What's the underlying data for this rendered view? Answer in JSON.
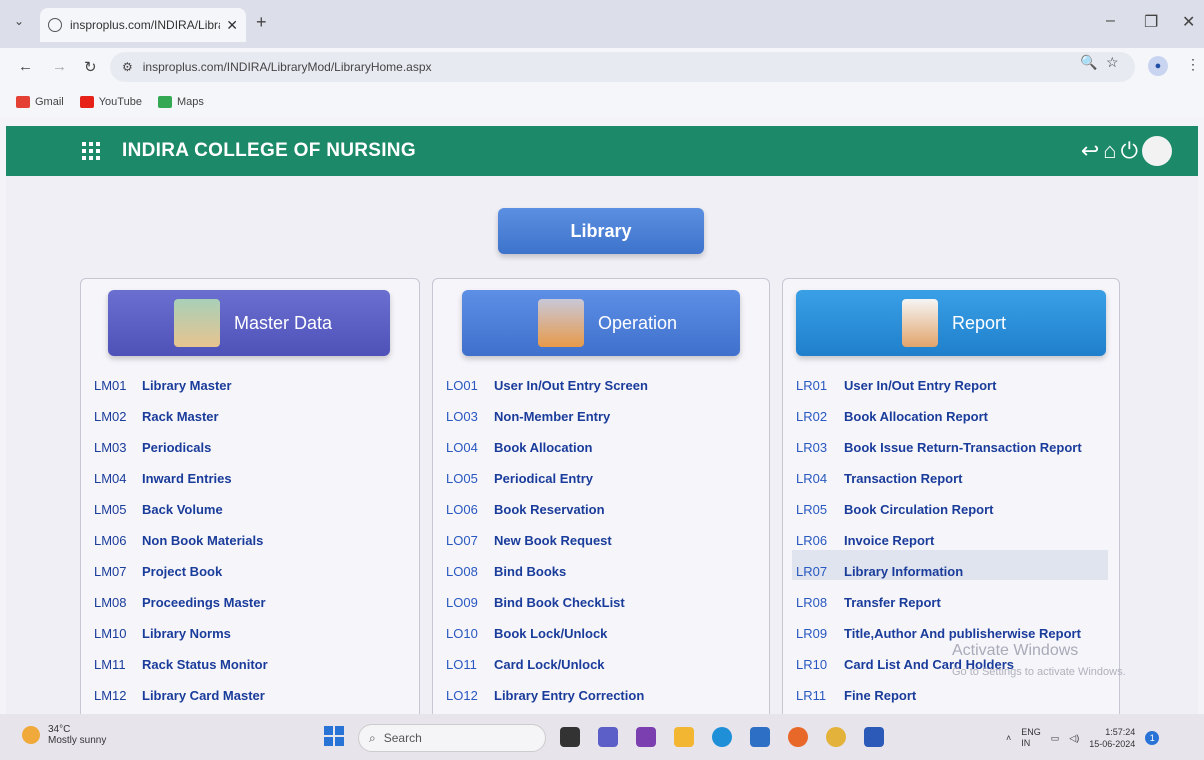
{
  "browser": {
    "tab_title": "insproplus.com/INDIRA/Librar",
    "url": "insproplus.com/INDIRA/LibraryMod/LibraryHome.aspx",
    "bookmarks": [
      "Gmail",
      "YouTube",
      "Maps"
    ]
  },
  "app": {
    "title": "INDIRA COLLEGE OF NURSING",
    "module_button": "Library"
  },
  "panels": [
    {
      "title": "Master Data",
      "color": "#5b5fc4",
      "items": [
        {
          "code": "LM01",
          "label": "Library Master"
        },
        {
          "code": "LM02",
          "label": "Rack Master"
        },
        {
          "code": "LM03",
          "label": "Periodicals"
        },
        {
          "code": "LM04",
          "label": "Inward Entries"
        },
        {
          "code": "LM05",
          "label": "Back Volume"
        },
        {
          "code": "LM06",
          "label": "Non Book Materials"
        },
        {
          "code": "LM07",
          "label": "Project Book"
        },
        {
          "code": "LM08",
          "label": "Proceedings Master"
        },
        {
          "code": "LM10",
          "label": "Library Norms"
        },
        {
          "code": "LM11",
          "label": "Rack Status Monitor"
        },
        {
          "code": "LM12",
          "label": "Library Card Master"
        }
      ]
    },
    {
      "title": "Operation",
      "color": "#4d7fd8",
      "items": [
        {
          "code": "LO01",
          "label": "User In/Out Entry Screen"
        },
        {
          "code": "LO03",
          "label": "Non-Member Entry"
        },
        {
          "code": "LO04",
          "label": "Book Allocation"
        },
        {
          "code": "LO05",
          "label": "Periodical Entry"
        },
        {
          "code": "LO06",
          "label": "Book Reservation"
        },
        {
          "code": "LO07",
          "label": "New Book Request"
        },
        {
          "code": "LO08",
          "label": "Bind Books"
        },
        {
          "code": "LO09",
          "label": "Bind Book CheckList"
        },
        {
          "code": "LO10",
          "label": "Book Lock/Unlock"
        },
        {
          "code": "LO11",
          "label": "Card Lock/Unlock"
        },
        {
          "code": "LO12",
          "label": "Library Entry Correction"
        }
      ]
    },
    {
      "title": "Report",
      "color": "#2a8fd8",
      "items": [
        {
          "code": "LR01",
          "label": "User In/Out Entry Report"
        },
        {
          "code": "LR02",
          "label": "Book Allocation Report"
        },
        {
          "code": "LR03",
          "label": "Book Issue Return-Transaction Report"
        },
        {
          "code": "LR04",
          "label": "Transaction Report"
        },
        {
          "code": "LR05",
          "label": "Book Circulation Report"
        },
        {
          "code": "LR06",
          "label": "Invoice Report"
        },
        {
          "code": "LR07",
          "label": "Library Information"
        },
        {
          "code": "LR08",
          "label": "Transfer Report"
        },
        {
          "code": "LR09",
          "label": "Title,Author And publisherwise Report"
        },
        {
          "code": "LR10",
          "label": "Card List And Card Holders"
        },
        {
          "code": "LR11",
          "label": "Fine Report"
        }
      ]
    }
  ],
  "watermark": {
    "line1": "Activate Windows",
    "line2": "Go to Settings to activate Windows."
  },
  "taskbar": {
    "temperature": "34°C",
    "weather": "Mostly sunny",
    "search_placeholder": "Search",
    "lang": "ENG",
    "region": "IN",
    "time": "1:57:24",
    "date": "15-06-2024",
    "notification_count": "1"
  }
}
